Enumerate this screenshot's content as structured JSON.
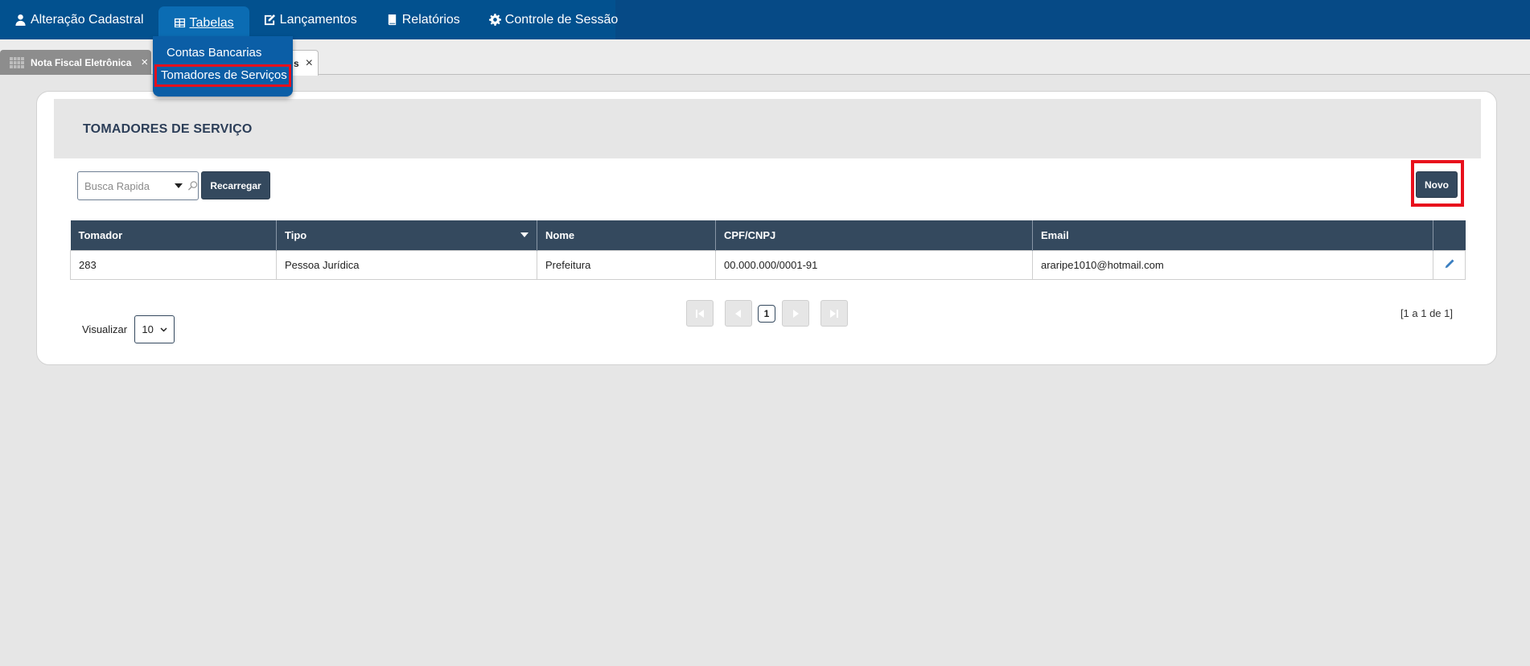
{
  "menu": {
    "items": [
      {
        "label": "Alteração Cadastral",
        "icon": "user-icon"
      },
      {
        "label": "Tabelas",
        "icon": "table-icon"
      },
      {
        "label": "Lançamentos",
        "icon": "edit-document-icon"
      },
      {
        "label": "Relatórios",
        "icon": "book-icon"
      },
      {
        "label": "Controle de Sessão",
        "icon": "gear-icon"
      }
    ],
    "dropdown": [
      "Contas Bancarias",
      "Tomadores de Serviços"
    ]
  },
  "tabs": [
    {
      "label": "Nota Fiscal Eletrônica",
      "close": "×"
    },
    {
      "label": "s",
      "close": "×"
    }
  ],
  "page": {
    "title": "TOMADORES DE SERVIÇO"
  },
  "toolbar": {
    "search_placeholder": "Busca Rapida",
    "reload_label": "Recarregar",
    "new_label": "Novo"
  },
  "table": {
    "columns": [
      "Tomador",
      "Tipo",
      "Nome",
      "CPF/CNPJ",
      "Email"
    ],
    "rows": [
      [
        "283",
        "Pessoa Jurídica",
        "Prefeitura",
        "00.000.000/0001-91",
        "araripe1010@hotmail.com"
      ]
    ]
  },
  "pagination": {
    "view_label": "Visualizar",
    "page_size": "10",
    "current_page": "1",
    "info": "[1 a 1 de 1]"
  },
  "colors": {
    "menubar": "#02518f",
    "header_dark": "#34495e",
    "highlight": "#e8101c"
  }
}
